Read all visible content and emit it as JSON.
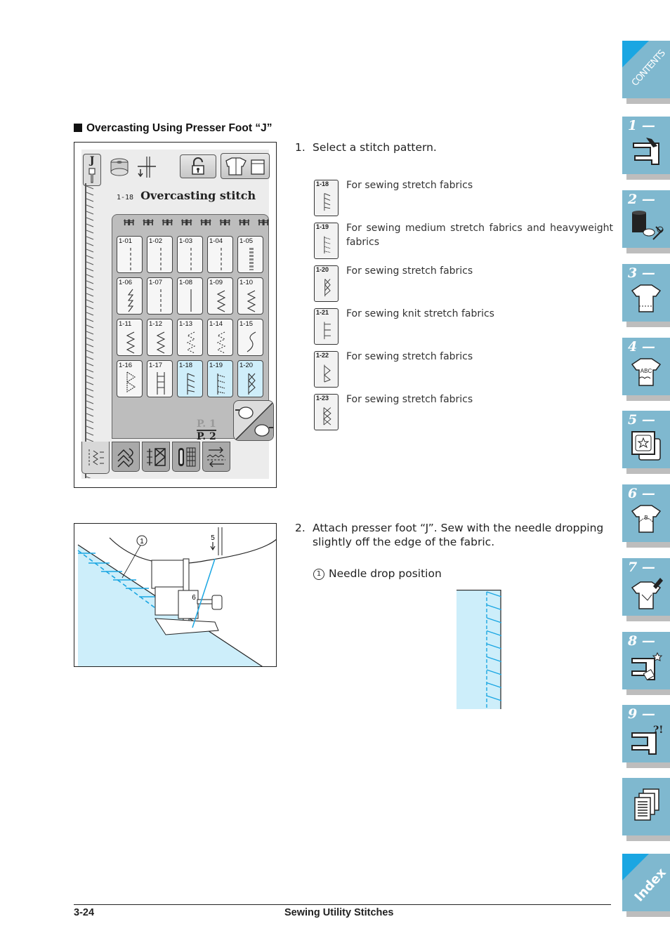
{
  "section": {
    "title": "Overcasting Using Presser Foot “J”"
  },
  "lcd": {
    "foot_label": "J",
    "selected_code": "1-18",
    "selected_name": "Overcasting stitch",
    "patterns": [
      {
        "code": "1-01",
        "selected": false
      },
      {
        "code": "1-02",
        "selected": false
      },
      {
        "code": "1-03",
        "selected": false
      },
      {
        "code": "1-04",
        "selected": false
      },
      {
        "code": "1-05",
        "selected": false
      },
      {
        "code": "1-06",
        "selected": false
      },
      {
        "code": "1-07",
        "selected": false
      },
      {
        "code": "1-08",
        "selected": false
      },
      {
        "code": "1-09",
        "selected": false
      },
      {
        "code": "1-10",
        "selected": false
      },
      {
        "code": "1-11",
        "selected": false
      },
      {
        "code": "1-12",
        "selected": false
      },
      {
        "code": "1-13",
        "selected": false
      },
      {
        "code": "1-14",
        "selected": false
      },
      {
        "code": "1-15",
        "selected": false
      },
      {
        "code": "1-16",
        "selected": false
      },
      {
        "code": "1-17",
        "selected": false
      },
      {
        "code": "1-18",
        "selected": true
      },
      {
        "code": "1-19",
        "selected": true
      },
      {
        "code": "1-20",
        "selected": true
      }
    ],
    "page_current": "P. 1",
    "page_total": "P. 2",
    "category_tabs": [
      "utility",
      "character",
      "decorative",
      "buttonhole",
      "direction"
    ]
  },
  "steps": [
    {
      "number": "1.",
      "text": "Select a stitch pattern."
    },
    {
      "number": "2.",
      "text": "Attach presser foot “J”. Sew with the needle dropping slightly off the edge of the fabric."
    }
  ],
  "pattern_list": [
    {
      "code": "1-18",
      "description": "For sewing stretch fabrics"
    },
    {
      "code": "1-19",
      "description": "For sewing medium stretch fabrics and heavyweight fabrics"
    },
    {
      "code": "1-20",
      "description": "For sewing stretch fabrics"
    },
    {
      "code": "1-21",
      "description": "For sewing knit stretch fabrics"
    },
    {
      "code": "1-22",
      "description": "For sewing stretch fabrics"
    },
    {
      "code": "1-23",
      "description": "For sewing  stretch fabrics"
    }
  ],
  "illustration": {
    "callout_number": "1",
    "needle_position": "5",
    "foot_marking": "6"
  },
  "callout": {
    "marker": "1",
    "text": "Needle drop position"
  },
  "footer": {
    "page_number": "3-24",
    "chapter_title": "Sewing Utility Stitches"
  },
  "sidebar": {
    "tabs": [
      {
        "label": "CONTENTS",
        "icon": "contents"
      },
      {
        "label": "1 —",
        "icon": "sewing-machine-hand-icon"
      },
      {
        "label": "2 —",
        "icon": "thread-spool-scissors-icon"
      },
      {
        "label": "3 —",
        "icon": "shirt-stitch-icon"
      },
      {
        "label": "4 —",
        "icon": "shirt-abc-icon"
      },
      {
        "label": "5 —",
        "icon": "embroidery-frame-icon"
      },
      {
        "label": "6 —",
        "icon": "shirt-edit-icon"
      },
      {
        "label": "7 —",
        "icon": "shirt-pen-icon"
      },
      {
        "label": "8 —",
        "icon": "machine-maintenance-icon"
      },
      {
        "label": "9 —",
        "icon": "machine-troubleshoot-icon"
      },
      {
        "label": "",
        "icon": "documents-icon"
      },
      {
        "label": "Index",
        "icon": "index"
      }
    ]
  },
  "colors": {
    "fabric_blue": "#cdeefa",
    "thread_blue": "#1aa6e2",
    "tab_blue": "#7fb8cf",
    "selected_cell": "#cfeefa"
  }
}
